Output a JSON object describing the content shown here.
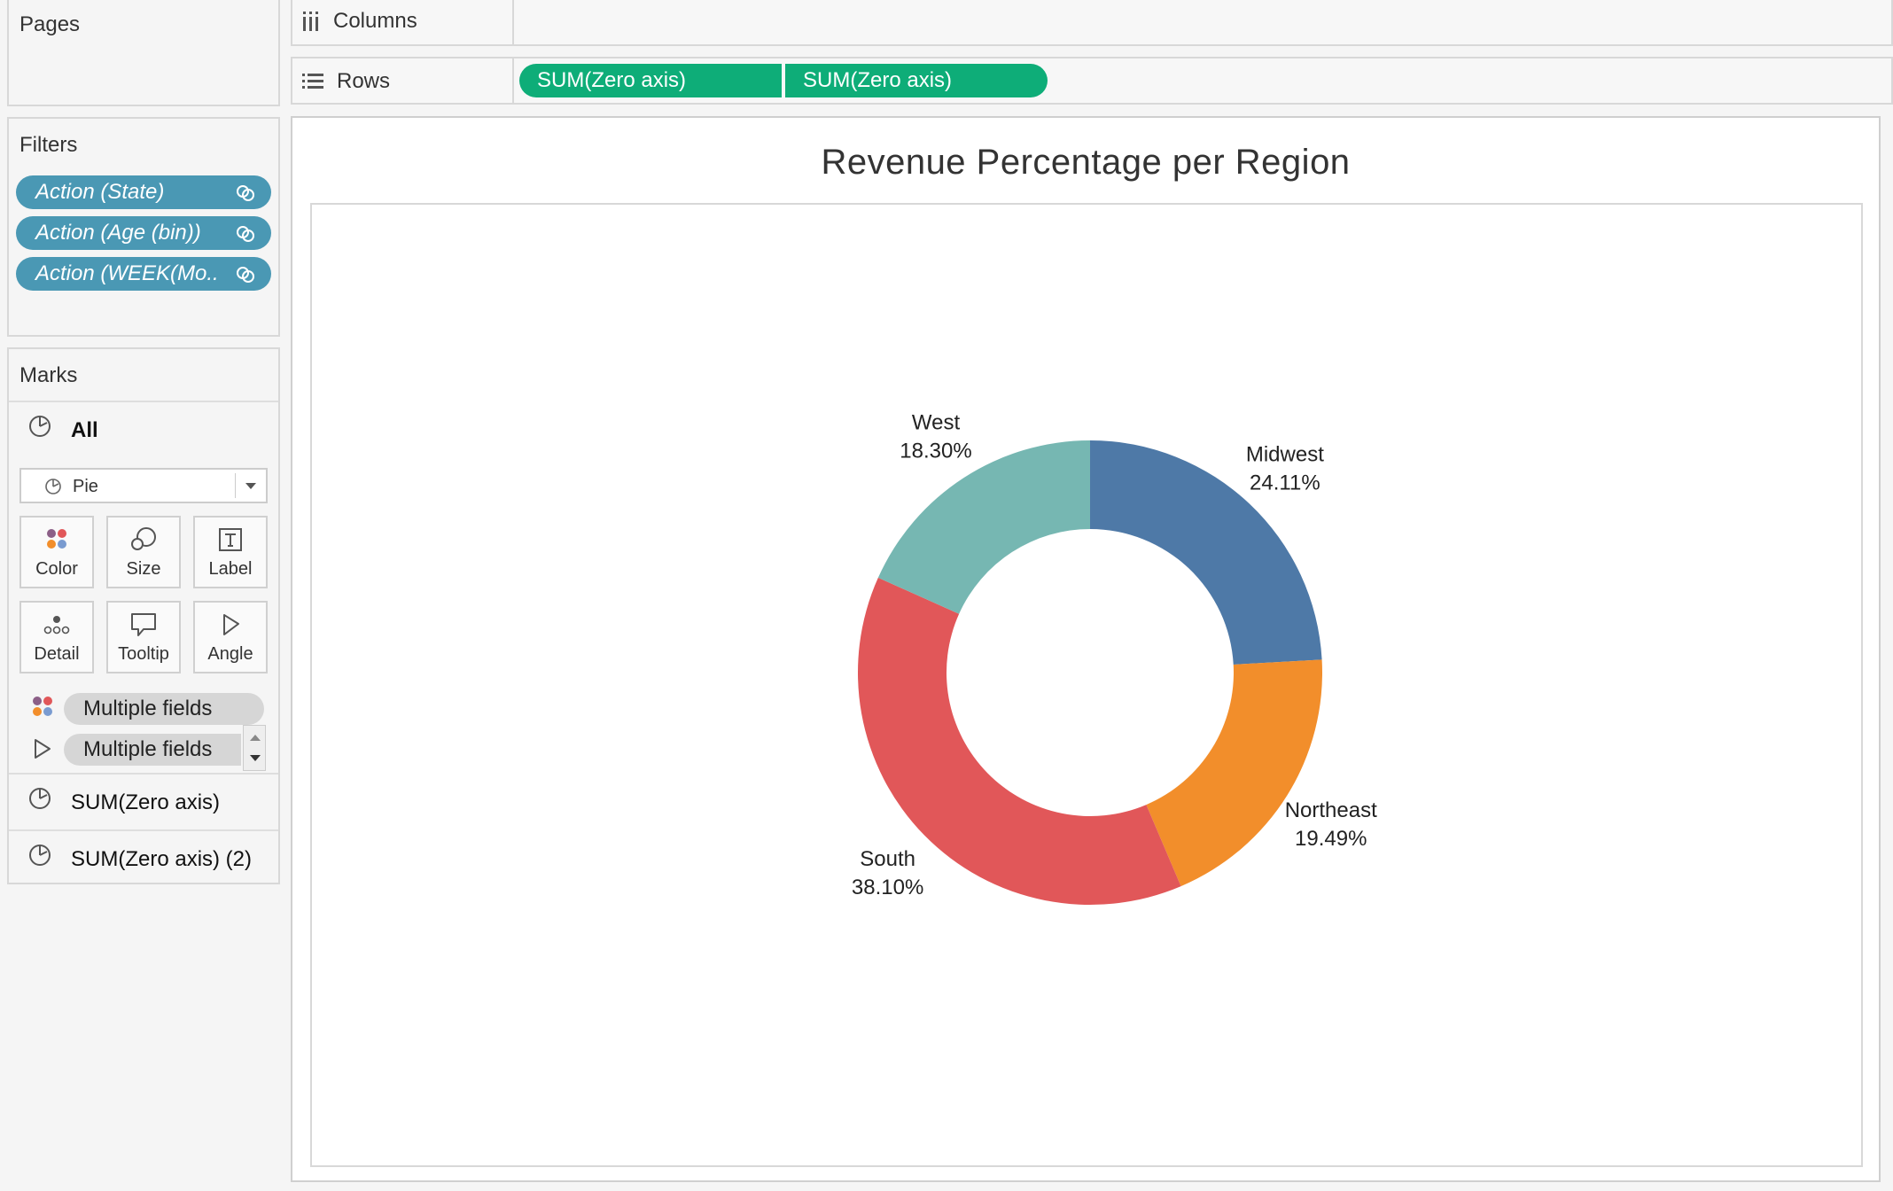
{
  "pages": {
    "title": "Pages"
  },
  "filters": {
    "title": "Filters",
    "items": [
      {
        "label": "Action (State)"
      },
      {
        "label": "Action (Age (bin))"
      },
      {
        "label": "Action (WEEK(Mo.."
      }
    ]
  },
  "marks": {
    "title": "Marks",
    "all_label": "All",
    "mark_type": "Pie",
    "buttons": {
      "color": "Color",
      "size": "Size",
      "label": "Label",
      "detail": "Detail",
      "tooltip": "Tooltip",
      "angle": "Angle"
    },
    "fields": [
      {
        "label": "Multiple fields",
        "icon": "color-dots-icon"
      },
      {
        "label": "Multiple fields",
        "icon": "angle-icon"
      }
    ],
    "layers": [
      {
        "label": "SUM(Zero axis)"
      },
      {
        "label": "SUM(Zero axis) (2)"
      }
    ]
  },
  "shelves": {
    "columns_label": "Columns",
    "rows_label": "Rows",
    "rows_pills": [
      "SUM(Zero axis)",
      "SUM(Zero axis)"
    ]
  },
  "colors": {
    "filter_pill": "#4a98b4",
    "rows_pill": "#0ead78"
  },
  "chart_data": {
    "type": "pie",
    "title": "Revenue Percentage per Region",
    "donut": true,
    "slices": [
      {
        "name": "Midwest",
        "value": 24.11,
        "label": "24.11%",
        "color": "#4e79a7"
      },
      {
        "name": "Northeast",
        "value": 19.49,
        "label": "19.49%",
        "color": "#f28e2b"
      },
      {
        "name": "South",
        "value": 38.1,
        "label": "38.10%",
        "color": "#e15759"
      },
      {
        "name": "West",
        "value": 18.3,
        "label": "18.30%",
        "color": "#76b7b2"
      }
    ]
  }
}
